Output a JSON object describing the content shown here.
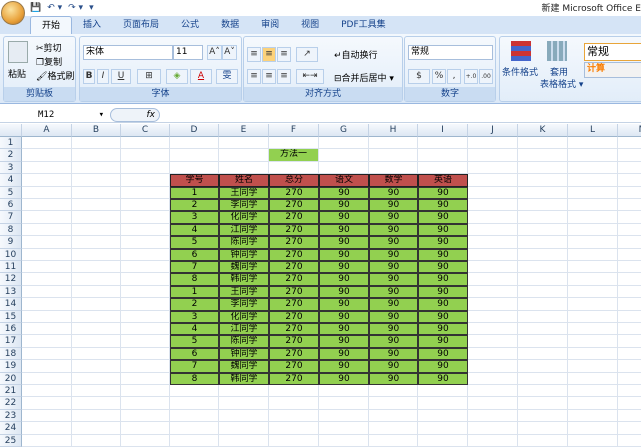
{
  "window": {
    "title": "新建 Microsoft Office E"
  },
  "qat": {
    "save": "💾",
    "undo": "↶ ▾",
    "redo": "↷ ▾",
    "more": "▾"
  },
  "tabs": [
    "开始",
    "插入",
    "页面布局",
    "公式",
    "数据",
    "审阅",
    "视图",
    "PDF工具集"
  ],
  "ribbon": {
    "clipboard": {
      "label": "剪贴板",
      "paste": "粘贴",
      "cut": "剪切",
      "copy": "复制",
      "format_painter": "格式刷"
    },
    "font": {
      "label": "字体",
      "font_name": "宋体",
      "font_size": "11",
      "bold": "B",
      "italic": "I",
      "underline": "U",
      "grow": "A˄",
      "shrink": "A˅",
      "border": "⊞",
      "fill": "◈",
      "color": "A",
      "phonetic": "雯"
    },
    "alignment": {
      "label": "对齐方式",
      "wrap": "自动换行",
      "merge": "合并后居中 ▾"
    },
    "number": {
      "label": "数字",
      "format": "常规",
      "percent": "%",
      "comma": ",",
      "inc": "+.0",
      "dec": ".00"
    },
    "styles": {
      "conditional": "条件格式",
      "table_format_1": "套用",
      "table_format_2": "表格格式 ▾",
      "style_normal": "常规",
      "style_calc": "计算"
    }
  },
  "formula_bar": {
    "name_box": "M12",
    "fx": "fx",
    "formula": ""
  },
  "columns": [
    "A",
    "B",
    "C",
    "D",
    "E",
    "F",
    "G",
    "H",
    "I",
    "J",
    "K",
    "L",
    "M"
  ],
  "rows": [
    "1",
    "2",
    "3",
    "4",
    "5",
    "6",
    "7",
    "8",
    "9",
    "10",
    "11",
    "12",
    "13",
    "14",
    "15",
    "16",
    "17",
    "18",
    "19",
    "20",
    "21",
    "22",
    "23",
    "24",
    "25"
  ],
  "sheet": {
    "title": "方法一",
    "headers": [
      "学号",
      "姓名",
      "总分",
      "语文",
      "数学",
      "英语"
    ],
    "records": [
      [
        "1",
        "王同学",
        "270",
        "90",
        "90",
        "90"
      ],
      [
        "2",
        "李同学",
        "270",
        "90",
        "90",
        "90"
      ],
      [
        "3",
        "化同学",
        "270",
        "90",
        "90",
        "90"
      ],
      [
        "4",
        "江同学",
        "270",
        "90",
        "90",
        "90"
      ],
      [
        "5",
        "陈同学",
        "270",
        "90",
        "90",
        "90"
      ],
      [
        "6",
        "钟同学",
        "270",
        "90",
        "90",
        "90"
      ],
      [
        "7",
        "魏同学",
        "270",
        "90",
        "90",
        "90"
      ],
      [
        "8",
        "韩同学",
        "270",
        "90",
        "90",
        "90"
      ],
      [
        "1",
        "王同学",
        "270",
        "90",
        "90",
        "90"
      ],
      [
        "2",
        "李同学",
        "270",
        "90",
        "90",
        "90"
      ],
      [
        "3",
        "化同学",
        "270",
        "90",
        "90",
        "90"
      ],
      [
        "4",
        "江同学",
        "270",
        "90",
        "90",
        "90"
      ],
      [
        "5",
        "陈同学",
        "270",
        "90",
        "90",
        "90"
      ],
      [
        "6",
        "钟同学",
        "270",
        "90",
        "90",
        "90"
      ],
      [
        "7",
        "魏同学",
        "270",
        "90",
        "90",
        "90"
      ],
      [
        "8",
        "韩同学",
        "270",
        "90",
        "90",
        "90"
      ]
    ]
  },
  "colors": {
    "header_fill": "#c0504d",
    "data_fill": "#92d050"
  }
}
